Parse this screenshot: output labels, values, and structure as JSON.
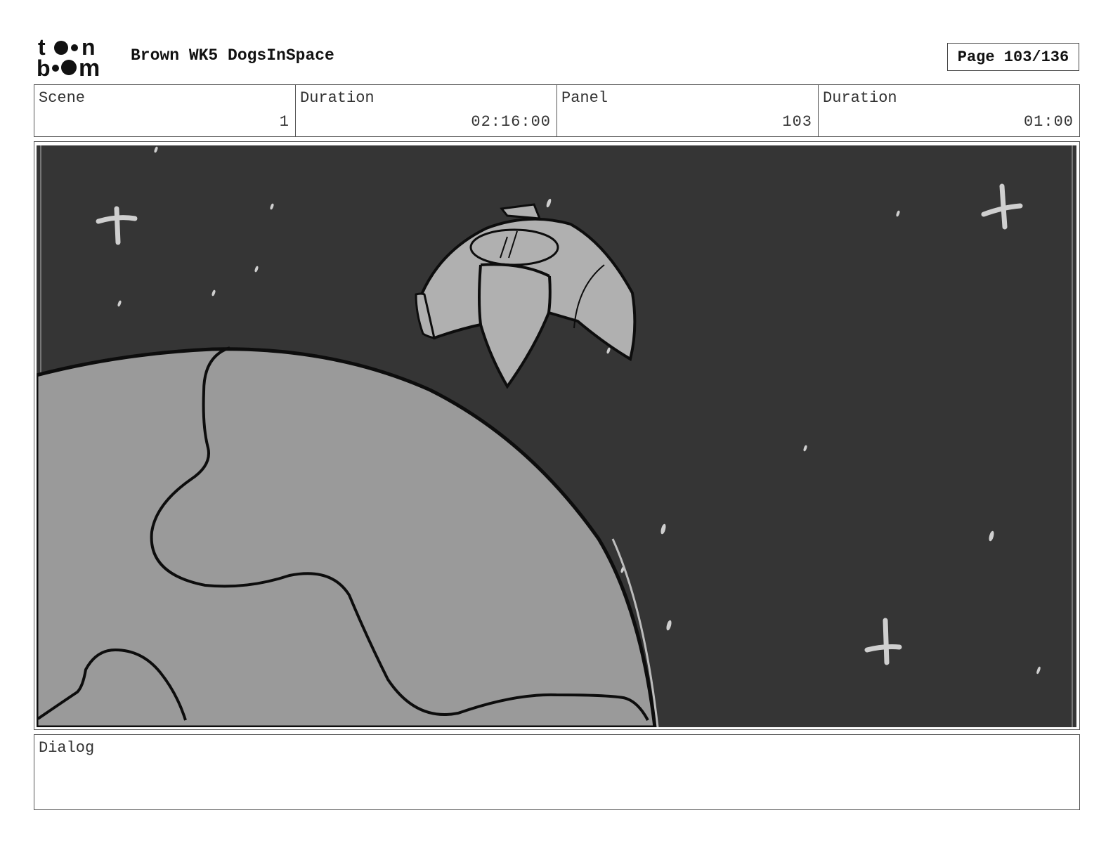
{
  "header": {
    "logo": {
      "icon": "toonboom-logo",
      "text_line1": "t",
      "text_line2": "b",
      "text_line1_end": "n",
      "text_line2_end": "m"
    },
    "project_title": "Brown WK5 DogsInSpace",
    "page_label": "Page 103/136"
  },
  "info": {
    "scene_label": "Scene",
    "scene_value": "1",
    "scene_duration_label": "Duration",
    "scene_duration_value": "02:16:00",
    "panel_label": "Panel",
    "panel_value": "103",
    "panel_duration_label": "Duration",
    "panel_duration_value": "01:00"
  },
  "panel": {
    "image": "storyboard-sketch",
    "depicts": [
      "planet",
      "spaceship",
      "stars"
    ],
    "colors": {
      "space": "#353535",
      "planet": "#9a9a9a",
      "ship": "#b0b0b0",
      "stars": "#d0d0d0",
      "line": "#0d0d0d"
    }
  },
  "dialog": {
    "label": "Dialog",
    "text": ""
  }
}
